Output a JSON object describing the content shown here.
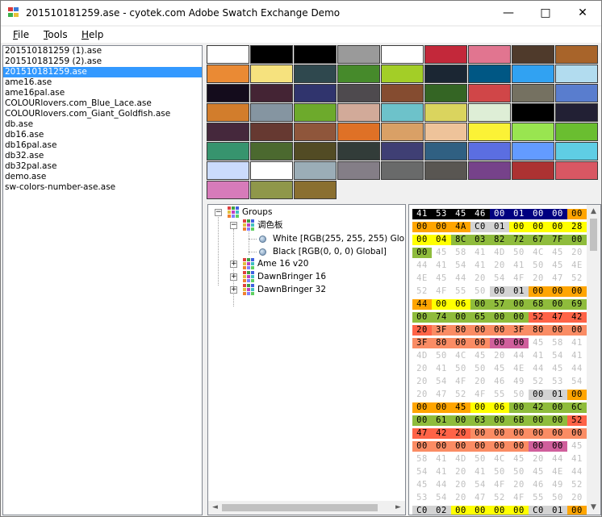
{
  "window": {
    "title": "201510181259.ase - cyotek.com Adobe Swatch Exchange Demo",
    "minimize_glyph": "—",
    "maximize_glyph": "□",
    "close_glyph": "✕"
  },
  "menu": {
    "file": {
      "first": "F",
      "rest": "ile"
    },
    "tools": {
      "first": "T",
      "rest": "ools"
    },
    "help": {
      "first": "H",
      "rest": "elp"
    }
  },
  "files": [
    "201510181259 (1).ase",
    "201510181259 (2).ase",
    "201510181259.ase",
    "ame16.ase",
    "ame16pal.ase",
    "COLOURlovers.com_Blue_Lace.ase",
    "COLOURlovers.com_Giant_Goldfish.ase",
    "db.ase",
    "db16.ase",
    "db16pal.ase",
    "db32.ase",
    "db32pal.ase",
    "demo.ase",
    "sw-colors-number-ase.ase"
  ],
  "selected_file_index": 2,
  "swatch_colors": [
    "#ffffff",
    "#000000",
    "#000000",
    "#9a9a9a",
    "#ffffff",
    "#c3283a",
    "#e17590",
    "#4f3a2b",
    "#a8642a",
    "#ea8a34",
    "#f6e27e",
    "#2f484e",
    "#468a2b",
    "#a3ce27",
    "#1b2633",
    "#005784",
    "#31a2f2",
    "#b2dcef",
    "#140c1c",
    "#442434",
    "#30346d",
    "#4e4a4e",
    "#854c30",
    "#346524",
    "#d04648",
    "#757161",
    "#597dce",
    "#d27d2c",
    "#8595a1",
    "#6daa2c",
    "#d2aa99",
    "#6dc2ca",
    "#dad45e",
    "#deeed6",
    "#000000",
    "#222034",
    "#45283c",
    "#663931",
    "#8f563b",
    "#df7126",
    "#d9a066",
    "#eec39a",
    "#fbf236",
    "#99e550",
    "#6abe30",
    "#37946e",
    "#4b692f",
    "#524b24",
    "#323c39",
    "#3f3f74",
    "#306082",
    "#5b6ee1",
    "#639bff",
    "#5fcde4",
    "#cbdbfc",
    "#ffffff",
    "#9badb7",
    "#847e87",
    "#696a6a",
    "#595652",
    "#76428a",
    "#ac3232",
    "#d95763",
    "#d77bba",
    "#8f974a",
    "#8a6f30"
  ],
  "tree": {
    "root": "Groups",
    "group1": "调色板",
    "white": "White [RGB(255, 255, 255) Global]",
    "black": "Black [RGB(0, 0, 0) Global]",
    "ame": "Ame 16 v20",
    "db16": "DawnBringer 16",
    "db32": "DawnBringer 32",
    "plus": "+",
    "minus": "−"
  },
  "hex_rows": [
    [
      [
        "41",
        "#000000",
        "#ffffff"
      ],
      [
        "53",
        "#000000",
        "#ffffff"
      ],
      [
        "45",
        "#000000",
        "#ffffff"
      ],
      [
        "46",
        "#000000",
        "#ffffff"
      ],
      [
        "00",
        "#000080",
        "#ffffff"
      ],
      [
        "01",
        "#000080",
        "#ffffff"
      ],
      [
        "00",
        "#000080",
        "#ffffff"
      ],
      [
        "00",
        "#000080",
        "#ffffff"
      ],
      [
        "00",
        "#ffa500",
        "#000000"
      ]
    ],
    [
      [
        "00",
        "#ffa500",
        "#000000"
      ],
      [
        "00",
        "#ffa500",
        "#000000"
      ],
      [
        "4A",
        "#ffa500",
        "#000000"
      ],
      [
        "C0",
        "#d3d3d3",
        "#000000"
      ],
      [
        "01",
        "#d3d3d3",
        "#000000"
      ],
      [
        "00",
        "#ffff00",
        "#000000"
      ],
      [
        "00",
        "#ffff00",
        "#000000"
      ],
      [
        "00",
        "#ffff00",
        "#000000"
      ],
      [
        "28",
        "#ffff00",
        "#000000"
      ]
    ],
    [
      [
        "00",
        "#ffff00",
        "#000000"
      ],
      [
        "04",
        "#ffff00",
        "#000000"
      ],
      [
        "8C",
        "#8fbc3c",
        "#000000"
      ],
      [
        "03",
        "#8fbc3c",
        "#000000"
      ],
      [
        "82",
        "#8fbc3c",
        "#000000"
      ],
      [
        "72",
        "#8fbc3c",
        "#000000"
      ],
      [
        "67",
        "#8fbc3c",
        "#000000"
      ],
      [
        "7F",
        "#8fbc3c",
        "#000000"
      ],
      [
        "00",
        "#8fbc3c",
        "#000000"
      ]
    ],
    [
      [
        "00",
        "#8fbc3c",
        "#000000"
      ],
      [
        "45",
        "#ffffff",
        "#c0c0c0"
      ],
      [
        "58",
        "#ffffff",
        "#c0c0c0"
      ],
      [
        "41",
        "#ffffff",
        "#c0c0c0"
      ],
      [
        "4D",
        "#ffffff",
        "#c0c0c0"
      ],
      [
        "50",
        "#ffffff",
        "#c0c0c0"
      ],
      [
        "4C",
        "#ffffff",
        "#c0c0c0"
      ],
      [
        "45",
        "#ffffff",
        "#c0c0c0"
      ],
      [
        "20",
        "#ffffff",
        "#c0c0c0"
      ]
    ],
    [
      [
        "44",
        "#ffffff",
        "#c0c0c0"
      ],
      [
        "41",
        "#ffffff",
        "#c0c0c0"
      ],
      [
        "54",
        "#ffffff",
        "#c0c0c0"
      ],
      [
        "41",
        "#ffffff",
        "#c0c0c0"
      ],
      [
        "20",
        "#ffffff",
        "#c0c0c0"
      ],
      [
        "41",
        "#ffffff",
        "#c0c0c0"
      ],
      [
        "50",
        "#ffffff",
        "#c0c0c0"
      ],
      [
        "45",
        "#ffffff",
        "#c0c0c0"
      ],
      [
        "4E",
        "#ffffff",
        "#c0c0c0"
      ]
    ],
    [
      [
        "4E",
        "#ffffff",
        "#c0c0c0"
      ],
      [
        "45",
        "#ffffff",
        "#c0c0c0"
      ],
      [
        "44",
        "#ffffff",
        "#c0c0c0"
      ],
      [
        "20",
        "#ffffff",
        "#c0c0c0"
      ],
      [
        "54",
        "#ffffff",
        "#c0c0c0"
      ],
      [
        "4F",
        "#ffffff",
        "#c0c0c0"
      ],
      [
        "20",
        "#ffffff",
        "#c0c0c0"
      ],
      [
        "47",
        "#ffffff",
        "#c0c0c0"
      ],
      [
        "52",
        "#ffffff",
        "#c0c0c0"
      ]
    ],
    [
      [
        "52",
        "#ffffff",
        "#c0c0c0"
      ],
      [
        "4F",
        "#ffffff",
        "#c0c0c0"
      ],
      [
        "55",
        "#ffffff",
        "#c0c0c0"
      ],
      [
        "50",
        "#ffffff",
        "#c0c0c0"
      ],
      [
        "00",
        "#d3d3d3",
        "#000000"
      ],
      [
        "01",
        "#d3d3d3",
        "#000000"
      ],
      [
        "00",
        "#ffa500",
        "#000000"
      ],
      [
        "00",
        "#ffa500",
        "#000000"
      ],
      [
        "00",
        "#ffa500",
        "#000000"
      ]
    ],
    [
      [
        "44",
        "#ffa500",
        "#000000"
      ],
      [
        "00",
        "#ffff00",
        "#000000"
      ],
      [
        "06",
        "#ffff00",
        "#000000"
      ],
      [
        "00",
        "#8fbc3c",
        "#000000"
      ],
      [
        "57",
        "#8fbc3c",
        "#000000"
      ],
      [
        "00",
        "#8fbc3c",
        "#000000"
      ],
      [
        "68",
        "#8fbc3c",
        "#000000"
      ],
      [
        "00",
        "#8fbc3c",
        "#000000"
      ],
      [
        "69",
        "#8fbc3c",
        "#000000"
      ]
    ],
    [
      [
        "00",
        "#8fbc3c",
        "#000000"
      ],
      [
        "74",
        "#8fbc3c",
        "#000000"
      ],
      [
        "00",
        "#8fbc3c",
        "#000000"
      ],
      [
        "65",
        "#8fbc3c",
        "#000000"
      ],
      [
        "00",
        "#8fbc3c",
        "#000000"
      ],
      [
        "00",
        "#8fbc3c",
        "#000000"
      ],
      [
        "52",
        "#ff6347",
        "#000000"
      ],
      [
        "47",
        "#ff6347",
        "#000000"
      ],
      [
        "42",
        "#ff6347",
        "#000000"
      ]
    ],
    [
      [
        "20",
        "#ff6347",
        "#000000"
      ],
      [
        "3F",
        "#fa8c64",
        "#000000"
      ],
      [
        "80",
        "#fa8c64",
        "#000000"
      ],
      [
        "00",
        "#fa8c64",
        "#000000"
      ],
      [
        "00",
        "#fa8c64",
        "#000000"
      ],
      [
        "3F",
        "#fa8c64",
        "#000000"
      ],
      [
        "80",
        "#fa8c64",
        "#000000"
      ],
      [
        "00",
        "#fa8c64",
        "#000000"
      ],
      [
        "00",
        "#fa8c64",
        "#000000"
      ]
    ],
    [
      [
        "3F",
        "#fa8c64",
        "#000000"
      ],
      [
        "80",
        "#fa8c64",
        "#000000"
      ],
      [
        "00",
        "#fa8c64",
        "#000000"
      ],
      [
        "00",
        "#fa8c64",
        "#000000"
      ],
      [
        "00",
        "#d05f9c",
        "#000000"
      ],
      [
        "00",
        "#d05f9c",
        "#000000"
      ],
      [
        "45",
        "#ffffff",
        "#c0c0c0"
      ],
      [
        "58",
        "#ffffff",
        "#c0c0c0"
      ],
      [
        "41",
        "#ffffff",
        "#c0c0c0"
      ]
    ],
    [
      [
        "4D",
        "#ffffff",
        "#c0c0c0"
      ],
      [
        "50",
        "#ffffff",
        "#c0c0c0"
      ],
      [
        "4C",
        "#ffffff",
        "#c0c0c0"
      ],
      [
        "45",
        "#ffffff",
        "#c0c0c0"
      ],
      [
        "20",
        "#ffffff",
        "#c0c0c0"
      ],
      [
        "44",
        "#ffffff",
        "#c0c0c0"
      ],
      [
        "41",
        "#ffffff",
        "#c0c0c0"
      ],
      [
        "54",
        "#ffffff",
        "#c0c0c0"
      ],
      [
        "41",
        "#ffffff",
        "#c0c0c0"
      ]
    ],
    [
      [
        "20",
        "#ffffff",
        "#c0c0c0"
      ],
      [
        "41",
        "#ffffff",
        "#c0c0c0"
      ],
      [
        "50",
        "#ffffff",
        "#c0c0c0"
      ],
      [
        "50",
        "#ffffff",
        "#c0c0c0"
      ],
      [
        "45",
        "#ffffff",
        "#c0c0c0"
      ],
      [
        "4E",
        "#ffffff",
        "#c0c0c0"
      ],
      [
        "44",
        "#ffffff",
        "#c0c0c0"
      ],
      [
        "45",
        "#ffffff",
        "#c0c0c0"
      ],
      [
        "44",
        "#ffffff",
        "#c0c0c0"
      ]
    ],
    [
      [
        "20",
        "#ffffff",
        "#c0c0c0"
      ],
      [
        "54",
        "#ffffff",
        "#c0c0c0"
      ],
      [
        "4F",
        "#ffffff",
        "#c0c0c0"
      ],
      [
        "20",
        "#ffffff",
        "#c0c0c0"
      ],
      [
        "46",
        "#ffffff",
        "#c0c0c0"
      ],
      [
        "49",
        "#ffffff",
        "#c0c0c0"
      ],
      [
        "52",
        "#ffffff",
        "#c0c0c0"
      ],
      [
        "53",
        "#ffffff",
        "#c0c0c0"
      ],
      [
        "54",
        "#ffffff",
        "#c0c0c0"
      ]
    ],
    [
      [
        "20",
        "#ffffff",
        "#c0c0c0"
      ],
      [
        "47",
        "#ffffff",
        "#c0c0c0"
      ],
      [
        "52",
        "#ffffff",
        "#c0c0c0"
      ],
      [
        "4F",
        "#ffffff",
        "#c0c0c0"
      ],
      [
        "55",
        "#ffffff",
        "#c0c0c0"
      ],
      [
        "50",
        "#ffffff",
        "#c0c0c0"
      ],
      [
        "00",
        "#d3d3d3",
        "#000000"
      ],
      [
        "01",
        "#d3d3d3",
        "#000000"
      ],
      [
        "00",
        "#ffa500",
        "#000000"
      ]
    ],
    [
      [
        "00",
        "#ffa500",
        "#000000"
      ],
      [
        "00",
        "#ffa500",
        "#000000"
      ],
      [
        "45",
        "#ffa500",
        "#000000"
      ],
      [
        "00",
        "#ffff00",
        "#000000"
      ],
      [
        "06",
        "#ffff00",
        "#000000"
      ],
      [
        "00",
        "#8fbc3c",
        "#000000"
      ],
      [
        "42",
        "#8fbc3c",
        "#000000"
      ],
      [
        "00",
        "#8fbc3c",
        "#000000"
      ],
      [
        "6C",
        "#8fbc3c",
        "#000000"
      ]
    ],
    [
      [
        "00",
        "#8fbc3c",
        "#000000"
      ],
      [
        "61",
        "#8fbc3c",
        "#000000"
      ],
      [
        "00",
        "#8fbc3c",
        "#000000"
      ],
      [
        "63",
        "#8fbc3c",
        "#000000"
      ],
      [
        "00",
        "#8fbc3c",
        "#000000"
      ],
      [
        "6B",
        "#8fbc3c",
        "#000000"
      ],
      [
        "00",
        "#8fbc3c",
        "#000000"
      ],
      [
        "00",
        "#8fbc3c",
        "#000000"
      ],
      [
        "52",
        "#ff6347",
        "#000000"
      ]
    ],
    [
      [
        "47",
        "#ff6347",
        "#000000"
      ],
      [
        "42",
        "#ff6347",
        "#000000"
      ],
      [
        "20",
        "#ff6347",
        "#000000"
      ],
      [
        "00",
        "#fa8c64",
        "#000000"
      ],
      [
        "00",
        "#fa8c64",
        "#000000"
      ],
      [
        "00",
        "#fa8c64",
        "#000000"
      ],
      [
        "00",
        "#fa8c64",
        "#000000"
      ],
      [
        "00",
        "#fa8c64",
        "#000000"
      ],
      [
        "00",
        "#fa8c64",
        "#000000"
      ]
    ],
    [
      [
        "00",
        "#fa8c64",
        "#000000"
      ],
      [
        "00",
        "#fa8c64",
        "#000000"
      ],
      [
        "00",
        "#fa8c64",
        "#000000"
      ],
      [
        "00",
        "#fa8c64",
        "#000000"
      ],
      [
        "00",
        "#fa8c64",
        "#000000"
      ],
      [
        "00",
        "#fa8c64",
        "#000000"
      ],
      [
        "00",
        "#d05f9c",
        "#000000"
      ],
      [
        "00",
        "#d05f9c",
        "#000000"
      ],
      [
        "45",
        "#ffffff",
        "#c0c0c0"
      ]
    ],
    [
      [
        "58",
        "#ffffff",
        "#c0c0c0"
      ],
      [
        "41",
        "#ffffff",
        "#c0c0c0"
      ],
      [
        "4D",
        "#ffffff",
        "#c0c0c0"
      ],
      [
        "50",
        "#ffffff",
        "#c0c0c0"
      ],
      [
        "4C",
        "#ffffff",
        "#c0c0c0"
      ],
      [
        "45",
        "#ffffff",
        "#c0c0c0"
      ],
      [
        "20",
        "#ffffff",
        "#c0c0c0"
      ],
      [
        "44",
        "#ffffff",
        "#c0c0c0"
      ],
      [
        "41",
        "#ffffff",
        "#c0c0c0"
      ]
    ],
    [
      [
        "54",
        "#ffffff",
        "#c0c0c0"
      ],
      [
        "41",
        "#ffffff",
        "#c0c0c0"
      ],
      [
        "20",
        "#ffffff",
        "#c0c0c0"
      ],
      [
        "41",
        "#ffffff",
        "#c0c0c0"
      ],
      [
        "50",
        "#ffffff",
        "#c0c0c0"
      ],
      [
        "50",
        "#ffffff",
        "#c0c0c0"
      ],
      [
        "45",
        "#ffffff",
        "#c0c0c0"
      ],
      [
        "4E",
        "#ffffff",
        "#c0c0c0"
      ],
      [
        "44",
        "#ffffff",
        "#c0c0c0"
      ]
    ],
    [
      [
        "45",
        "#ffffff",
        "#c0c0c0"
      ],
      [
        "44",
        "#ffffff",
        "#c0c0c0"
      ],
      [
        "20",
        "#ffffff",
        "#c0c0c0"
      ],
      [
        "54",
        "#ffffff",
        "#c0c0c0"
      ],
      [
        "4F",
        "#ffffff",
        "#c0c0c0"
      ],
      [
        "20",
        "#ffffff",
        "#c0c0c0"
      ],
      [
        "46",
        "#ffffff",
        "#c0c0c0"
      ],
      [
        "49",
        "#ffffff",
        "#c0c0c0"
      ],
      [
        "52",
        "#ffffff",
        "#c0c0c0"
      ]
    ],
    [
      [
        "53",
        "#ffffff",
        "#c0c0c0"
      ],
      [
        "54",
        "#ffffff",
        "#c0c0c0"
      ],
      [
        "20",
        "#ffffff",
        "#c0c0c0"
      ],
      [
        "47",
        "#ffffff",
        "#c0c0c0"
      ],
      [
        "52",
        "#ffffff",
        "#c0c0c0"
      ],
      [
        "4F",
        "#ffffff",
        "#c0c0c0"
      ],
      [
        "55",
        "#ffffff",
        "#c0c0c0"
      ],
      [
        "50",
        "#ffffff",
        "#c0c0c0"
      ],
      [
        "20",
        "#ffffff",
        "#c0c0c0"
      ]
    ],
    [
      [
        "C0",
        "#d3d3d3",
        "#000000"
      ],
      [
        "02",
        "#d3d3d3",
        "#000000"
      ],
      [
        "00",
        "#ffff00",
        "#000000"
      ],
      [
        "00",
        "#ffff00",
        "#000000"
      ],
      [
        "00",
        "#ffff00",
        "#000000"
      ],
      [
        "00",
        "#ffff00",
        "#000000"
      ],
      [
        "C0",
        "#d3d3d3",
        "#000000"
      ],
      [
        "01",
        "#d3d3d3",
        "#000000"
      ],
      [
        "00",
        "#ffa500",
        "#000000"
      ]
    ]
  ],
  "scroll": {
    "up": "▲",
    "down": "▼",
    "left": "◄",
    "right": "►"
  }
}
